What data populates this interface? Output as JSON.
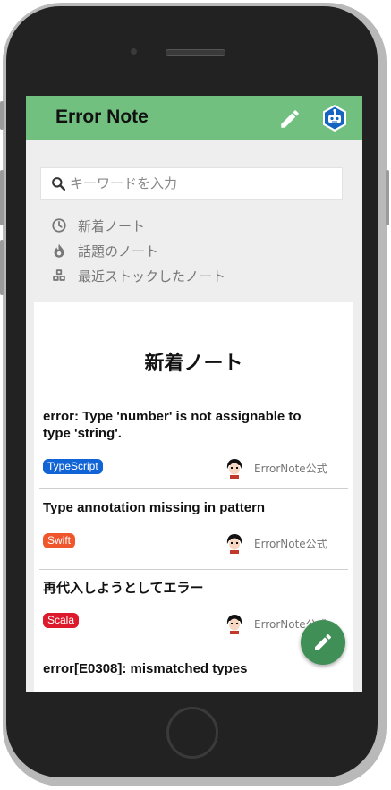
{
  "app": {
    "title": "Error Note"
  },
  "search": {
    "placeholder": "キーワードを入力"
  },
  "menu": [
    {
      "label": "新着ノート",
      "icon": "clock-icon"
    },
    {
      "label": "話題のノート",
      "icon": "flame-icon"
    },
    {
      "label": "最近ストックしたノート",
      "icon": "cubes-icon"
    }
  ],
  "section": {
    "title": "新着ノート"
  },
  "notes": [
    {
      "title": "error: Type 'number' is not assignable to type 'string'.",
      "tag": "TypeScript",
      "tag_color": "#1164d6",
      "author": "ErrorNote公式"
    },
    {
      "title": "Type annotation missing in pattern",
      "tag": "Swift",
      "tag_color": "#f0562b",
      "author": "ErrorNote公式"
    },
    {
      "title": "再代入しようとしてエラー",
      "tag": "Scala",
      "tag_color": "#dc1a2b",
      "author": "ErrorNote公式"
    },
    {
      "title": "error[E0308]: mismatched types"
    }
  ],
  "colors": {
    "appbar": "#71c07f",
    "fab": "#3f8f56",
    "background": "#eeeeee"
  }
}
